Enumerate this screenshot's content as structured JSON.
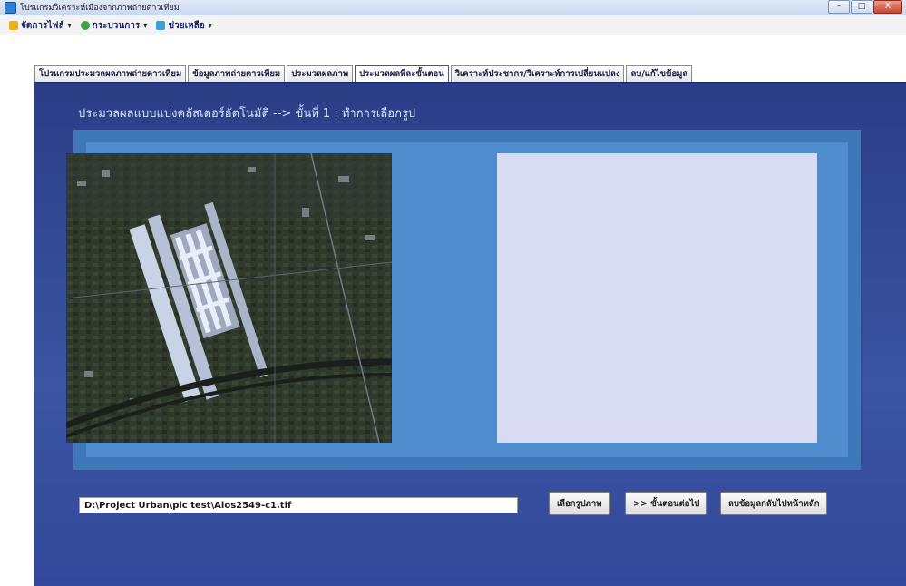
{
  "window": {
    "title": "โปรแกรมวิเคราะห์เมืองจากภาพถ่ายดาวเทียม",
    "controls": [
      "–",
      "□",
      "X"
    ]
  },
  "menu": [
    {
      "label": "จัดการไฟล์",
      "icon": "folder-icon",
      "color": "#e8b21a"
    },
    {
      "label": "กระบวนการ",
      "icon": "gear-icon",
      "color": "#43a047"
    },
    {
      "label": "ช่วยเหลือ",
      "icon": "help-icon",
      "color": "#3aa0d8"
    }
  ],
  "tabs": [
    {
      "label": "โปรแกรมประมวลผลภาพถ่ายดาวเทียม",
      "active": false
    },
    {
      "label": "ข้อมูลภาพถ่ายดาวเทียม",
      "active": false
    },
    {
      "label": "ประมวลผลภาพ",
      "active": false
    },
    {
      "label": "ประมวลผลทีละขั้นตอน",
      "active": true
    },
    {
      "label": "วิเคราะห์ประชากร/วิเคราะห์การเปลี่ยนแปลง",
      "active": false
    },
    {
      "label": "ลบ/แก้ไขข้อมูล",
      "active": false
    }
  ],
  "panel": {
    "heading": "ประมวลผลแบบแบ่งคลัสเตอร์อัตโนมัติ --> ขั้นที่ 1 : ทำการเลือกรูป",
    "file_path": "D:\\Project Urban\\pic test\\Alos2549-c1.tif",
    "buttons": {
      "select_image": "เลือกรูปภาพ",
      "next_step": ">> ขั้นตอนต่อไป",
      "save_back": "ลบข้อมูลกลับไปหน้าหลัก"
    }
  },
  "colors": {
    "panel_dark": "#2b3d86",
    "frame": "#3f78b8",
    "frame_inner": "#4f8ccd",
    "preview": "#d8dbf1"
  }
}
